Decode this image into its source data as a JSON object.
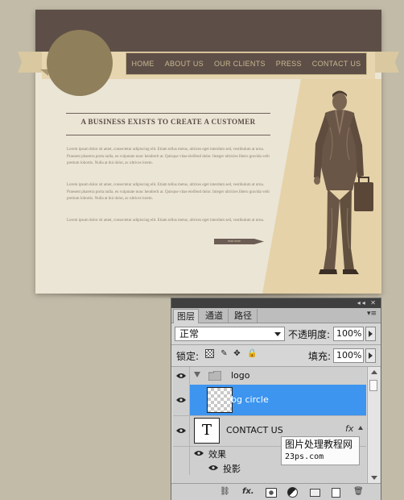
{
  "mockup": {
    "nav_items": [
      "HOME",
      "ABOUT US",
      "OUR CLIENTS",
      "PRESS",
      "CONTACT US"
    ],
    "headline": "A BUSINESS EXISTS TO CREATE A CUSTOMER",
    "paragraphs": [
      "Lorem ipsum dolor sit amet, consectetur adipiscing elit. Etiam tellus metus, ultrices eget interdum sed, vestibulum at urna. Praesent pharetra porta nulla, eu vulputate nunc hendrerit at. Quisque vitae eleifend dolor. Integer ultricies libero gravida velit pretium lobortis. Nulla at dui dolor, ac ultrices lorem.",
      "Lorem ipsum dolor sit amet, consectetur adipiscing elit. Etiam tellus metus, ultrices eget interdum sed, vestibulum at urna. Praesent pharetra porta nulla, eu vulputate nunc hendrerit at. Quisque vitae eleifend dolor. Integer ultricies libero gravida velit pretium lobortis. Nulla at dui dolor, ac ultrices lorem.",
      "Lorem ipsum dolor sit amet, consectetur adipiscing elit. Etiam tellus metus, ultrices eget interdum sed, vestibulum at urna."
    ],
    "more_button": "read more",
    "colors": {
      "background": "#c1bba8",
      "header": "#5d4f47",
      "paper": "#ebe5d6",
      "ribbon": "#e6d5ae",
      "logo_circle": "#8f7f5b",
      "accent_panel": "#e6d2a8"
    }
  },
  "layers_panel": {
    "titlebar_buttons": "◂◂ ✕",
    "tabs": [
      "图层",
      "通道",
      "路径"
    ],
    "menu_icon": "▾≡",
    "blend_mode": "正常",
    "opacity_label": "不透明度:",
    "opacity_value": "100%",
    "lock_label": "锁定:",
    "lock_icons": [
      "lock-transparent-icon",
      "lock-image-icon",
      "lock-position-icon",
      "lock-all-icon"
    ],
    "fill_label": "填充:",
    "fill_value": "100%",
    "layers": [
      {
        "name": "logo",
        "type": "group"
      },
      {
        "name": "bg circle",
        "type": "layer",
        "selected": true
      },
      {
        "name": "CONTACT US",
        "type": "text",
        "thumb": "T",
        "fx": "fx"
      },
      {
        "name": "效果",
        "type": "effects"
      },
      {
        "name": "投影",
        "type": "effect"
      }
    ],
    "bottom_icons": [
      "link-icon",
      "fx-icon",
      "mask-icon",
      "adjustment-icon",
      "new-group-icon",
      "new-layer-icon",
      "trash-icon"
    ],
    "bottom_fx_label": "fx.",
    "selection_color": "#3d95ef"
  },
  "watermark": {
    "line1": "图片处理教程网",
    "line2": "23ps.com"
  }
}
